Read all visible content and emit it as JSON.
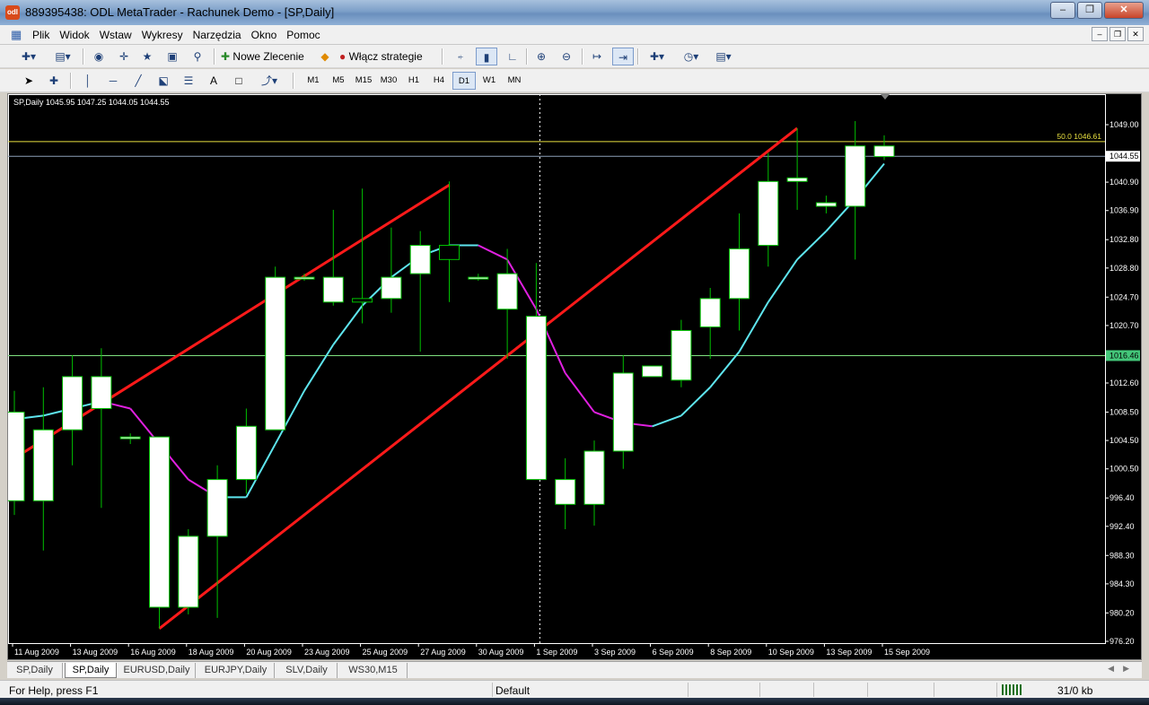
{
  "window": {
    "title": "889395438: ODL MetaTrader - Rachunek Demo - [SP,Daily]",
    "app_icon": "metatrader-icon"
  },
  "menu": {
    "items": [
      "Plik",
      "Widok",
      "Wstaw",
      "Wykresy",
      "Narzędzia",
      "Okno",
      "Pomoc"
    ]
  },
  "toolbar": {
    "new_order_label": "Nowe Zlecenie",
    "strategies_label": "Włącz strategie",
    "timeframes": [
      "M1",
      "M5",
      "M15",
      "M30",
      "H1",
      "H4",
      "D1",
      "W1",
      "MN"
    ],
    "active_timeframe": "D1"
  },
  "chart": {
    "info": "SP,Daily  1045.95 1047.25 1044.05 1044.55",
    "fibo_label": "50.0 1046.61",
    "bid_label": "1044.55",
    "hline_label": "1016.46",
    "colors": {
      "background": "#000000",
      "grid_text": "#ffffff",
      "bull_body": "#ffffff",
      "candle_outline": "#00c000",
      "trend": "#ff1a1a",
      "ma_up": "#5ee5ee",
      "ma_down": "#e020e0",
      "fibo": "#e8e040",
      "hline": "#7ee07e"
    }
  },
  "chart_data": {
    "type": "candlestick",
    "symbol": "SP",
    "timeframe": "Daily",
    "ylim": [
      976.2,
      1049.0
    ],
    "y_ticks": [
      "1049.00",
      "1044.55",
      "1040.90",
      "1036.90",
      "1032.80",
      "1028.80",
      "1024.70",
      "1020.70",
      "1016.46",
      "1012.60",
      "1008.50",
      "1004.50",
      "1000.50",
      "996.40",
      "992.40",
      "988.30",
      "984.30",
      "980.20",
      "976.20"
    ],
    "x_ticks": [
      "11 Aug 2009",
      "13 Aug 2009",
      "16 Aug 2009",
      "18 Aug 2009",
      "20 Aug 2009",
      "23 Aug 2009",
      "25 Aug 2009",
      "27 Aug 2009",
      "30 Aug 2009",
      "1 Sep 2009",
      "3 Sep 2009",
      "6 Sep 2009",
      "8 Sep 2009",
      "10 Sep 2009",
      "13 Sep 2009",
      "15 Sep 2009"
    ],
    "candles": [
      {
        "o": 996.0,
        "h": 1011.5,
        "l": 994.0,
        "c": 1008.5
      },
      {
        "o": 996.0,
        "h": 1012.0,
        "l": 989.0,
        "c": 1006.0
      },
      {
        "o": 1006.0,
        "h": 1016.5,
        "l": 1001.0,
        "c": 1013.5
      },
      {
        "o": 1009.0,
        "h": 1017.5,
        "l": 995.0,
        "c": 1013.5
      },
      {
        "o": 1005.0,
        "h": 1005.5,
        "l": 1004.0,
        "c": 1005.0
      },
      {
        "o": 981.0,
        "h": 1005.0,
        "l": 978.0,
        "c": 1005.0
      },
      {
        "o": 981.0,
        "h": 992.0,
        "l": 980.0,
        "c": 991.0
      },
      {
        "o": 991.0,
        "h": 1001.0,
        "l": 979.5,
        "c": 999.0
      },
      {
        "o": 999.0,
        "h": 1009.0,
        "l": 997.0,
        "c": 1006.5
      },
      {
        "o": 1006.0,
        "h": 1029.0,
        "l": 1006.0,
        "c": 1027.5
      },
      {
        "o": 1027.5,
        "h": 1028.0,
        "l": 1027.0,
        "c": 1027.5
      },
      {
        "o": 1024.0,
        "h": 1037.0,
        "l": 1023.5,
        "c": 1027.5
      },
      {
        "o": 1024.5,
        "h": 1040.0,
        "l": 1021.0,
        "c": 1024.0
      },
      {
        "o": 1024.5,
        "h": 1034.5,
        "l": 1022.5,
        "c": 1027.5
      },
      {
        "o": 1028.0,
        "h": 1034.0,
        "l": 1017.0,
        "c": 1032.0
      },
      {
        "o": 1032.0,
        "h": 1041.0,
        "l": 1024.0,
        "c": 1030.0
      },
      {
        "o": 1027.5,
        "h": 1028.0,
        "l": 1027.0,
        "c": 1027.5
      },
      {
        "o": 1023.0,
        "h": 1031.5,
        "l": 1016.0,
        "c": 1028.0
      },
      {
        "o": 999.0,
        "h": 1029.5,
        "l": 999.0,
        "c": 1022.0
      },
      {
        "o": 995.5,
        "h": 1002.0,
        "l": 992.0,
        "c": 999.0
      },
      {
        "o": 995.5,
        "h": 1004.5,
        "l": 992.5,
        "c": 1003.0
      },
      {
        "o": 1003.0,
        "h": 1016.5,
        "l": 1000.5,
        "c": 1014.0
      },
      {
        "o": 1013.5,
        "h": 1015.0,
        "l": 1013.5,
        "c": 1015.0
      },
      {
        "o": 1013.0,
        "h": 1021.5,
        "l": 1012.0,
        "c": 1020.0
      },
      {
        "o": 1020.5,
        "h": 1026.0,
        "l": 1016.0,
        "c": 1024.5
      },
      {
        "o": 1024.5,
        "h": 1036.5,
        "l": 1020.0,
        "c": 1031.5
      },
      {
        "o": 1032.0,
        "h": 1045.0,
        "l": 1029.0,
        "c": 1041.0
      },
      {
        "o": 1041.0,
        "h": 1048.5,
        "l": 1037.0,
        "c": 1041.5
      },
      {
        "o": 1037.5,
        "h": 1039.0,
        "l": 1036.5,
        "c": 1038.0
      },
      {
        "o": 1037.5,
        "h": 1049.5,
        "l": 1030.0,
        "c": 1046.0
      },
      {
        "o": 1044.5,
        "h": 1047.5,
        "l": 1044.0,
        "c": 1046.0
      }
    ],
    "moving_average": [
      1007.5,
      1008.0,
      1009.0,
      1010.0,
      1009.0,
      1004.0,
      999.0,
      996.5,
      996.5,
      1004.0,
      1011.5,
      1018.0,
      1023.5,
      1027.5,
      1030.5,
      1032.0,
      1032.0,
      1030.0,
      1023.0,
      1014.0,
      1008.5,
      1007.0,
      1006.5,
      1008.0,
      1012.0,
      1017.0,
      1024.0,
      1030.0,
      1034.0,
      1038.5,
      1043.5
    ],
    "trendlines": [
      {
        "x1": 0,
        "y1": 1002.0,
        "x2": 15,
        "y2": 1040.5
      },
      {
        "x1": 5,
        "y1": 978.0,
        "x2": 27,
        "y2": 1048.5
      }
    ],
    "hlines": [
      1046.61,
      1044.55,
      1016.46
    ],
    "vline_index": 18
  },
  "tabs": [
    "SP,Daily",
    "SP,Daily",
    "EURUSD,Daily",
    "EURJPY,Daily",
    "SLV,Daily",
    "WS30,M15"
  ],
  "active_tab": 1,
  "status": {
    "help": "For Help, press F1",
    "profile": "Default",
    "traffic": "31/0 kb"
  }
}
